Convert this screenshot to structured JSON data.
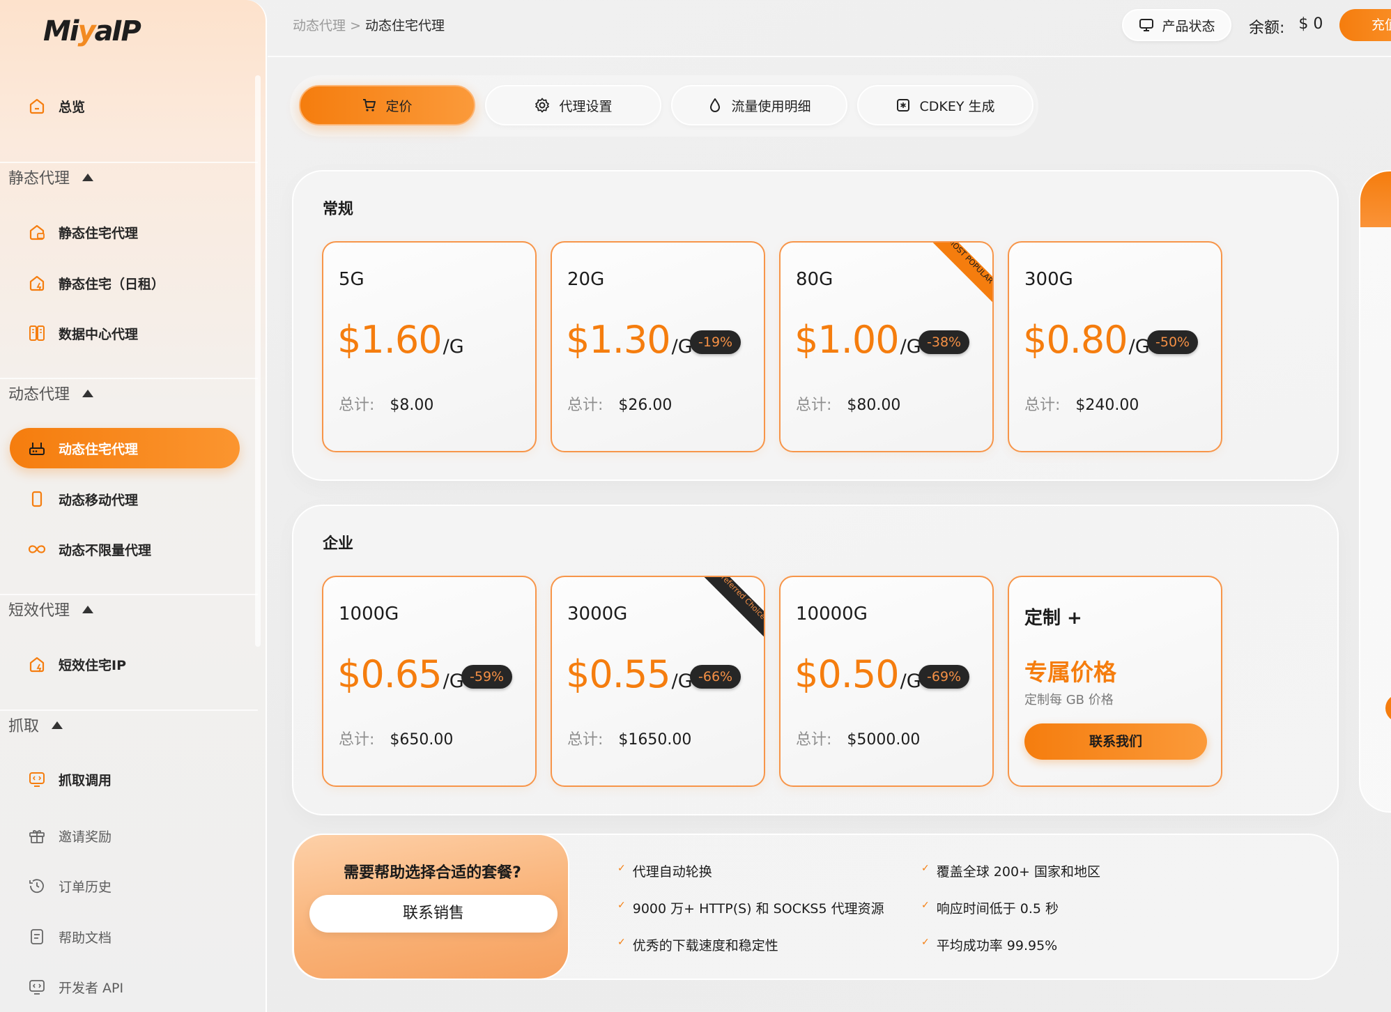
{
  "brand": {
    "logo_prefix": "Mi",
    "logo_y": "y",
    "logo_suffix": "aIP"
  },
  "sidebar": {
    "overview": "总览",
    "sections": {
      "static": "静态代理",
      "dynamic": "动态代理",
      "short": "短效代理",
      "scrape": "抓取"
    },
    "items": {
      "static_residential": "静态住宅代理",
      "static_daily": "静态住宅（日租）",
      "datacenter": "数据中心代理",
      "dynamic_residential": "动态住宅代理",
      "dynamic_mobile": "动态移动代理",
      "dynamic_unlimited": "动态不限量代理",
      "short_residential": "短效住宅IP",
      "scrape_api": "抓取调用",
      "invite": "邀请奖励",
      "orders": "订单历史",
      "docs": "帮助文档",
      "dev_api": "开发者 API"
    },
    "active_item": "dynamic_residential"
  },
  "header": {
    "breadcrumb_parent": "动态代理",
    "breadcrumb_sep": ">",
    "breadcrumb_current": "动态住宅代理",
    "status_button": "产品状态",
    "balance_label": "余额:",
    "balance_value": "$ 0",
    "recharge_button": "充值"
  },
  "tabs": {
    "pricing": "定价",
    "settings": "代理设置",
    "usage": "流量使用明细",
    "cdkey": "CDKEY 生成",
    "active": "pricing"
  },
  "regular": {
    "title": "常规",
    "plans": [
      {
        "size": "5G",
        "price": "$1.60",
        "unit": "/G",
        "discount": "",
        "total_label": "总计:",
        "total": "$8.00"
      },
      {
        "size": "20G",
        "price": "$1.30",
        "unit": "/G",
        "discount": "-19%",
        "total_label": "总计:",
        "total": "$26.00"
      },
      {
        "size": "80G",
        "price": "$1.00",
        "unit": "/G",
        "discount": "-38%",
        "total_label": "总计:",
        "total": "$80.00",
        "ribbon": "MOST POPULAR"
      },
      {
        "size": "300G",
        "price": "$0.80",
        "unit": "/G",
        "discount": "-50%",
        "total_label": "总计:",
        "total": "$240.00"
      }
    ]
  },
  "enterprise": {
    "title": "企业",
    "plans": [
      {
        "size": "1000G",
        "price": "$0.65",
        "unit": "/G",
        "discount": "-59%",
        "total_label": "总计:",
        "total": "$650.00"
      },
      {
        "size": "3000G",
        "price": "$0.55",
        "unit": "/G",
        "discount": "-66%",
        "total_label": "总计:",
        "total": "$1650.00",
        "ribbon": "Preferred Choice"
      },
      {
        "size": "10000G",
        "price": "$0.50",
        "unit": "/G",
        "discount": "-69%",
        "total_label": "总计:",
        "total": "$5000.00"
      }
    ],
    "custom": {
      "title": "定制 +",
      "price": "专属价格",
      "subtitle": "定制每 GB 价格",
      "button": "联系我们"
    }
  },
  "help": {
    "title": "需要帮助选择合适的套餐?",
    "button": "联系销售",
    "features": [
      "代理自动轮换",
      "9000 万+ HTTP(S) 和 SOCKS5 代理资源",
      "优秀的下载速度和稳定性",
      "覆盖全球 200+ 国家和地区",
      "响应时间低于 0.5 秒",
      "平均成功率 99.95%"
    ]
  },
  "colors": {
    "accent": "#f57d0e",
    "badge_bg": "#262626",
    "badge_text": "#f59045"
  }
}
